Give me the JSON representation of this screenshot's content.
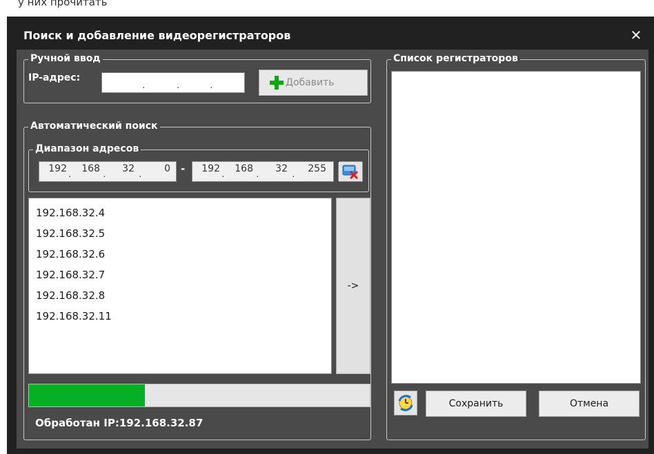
{
  "window": {
    "title": "Поиск и добавление видеорегистраторов",
    "close_glyph": "✕"
  },
  "manual_input": {
    "legend": "Ручной ввод",
    "ip_label": "IP-адрес:",
    "ip_octets": [
      "",
      "",
      "",
      ""
    ],
    "add_button": {
      "label": "Добавить",
      "icon": "plus-icon",
      "enabled": false
    }
  },
  "auto_search": {
    "legend": "Автоматический поиск",
    "range": {
      "legend": "Диапазон адресов",
      "from": [
        "192",
        "168",
        "32",
        "0"
      ],
      "separator": "-",
      "to": [
        "192",
        "168",
        "32",
        "255"
      ],
      "action_icon": "stop-search-icon"
    },
    "found": [
      "192.168.32.4",
      "192.168.32.5",
      "192.168.32.6",
      "192.168.32.7",
      "192.168.32.8",
      "192.168.32.11"
    ],
    "transfer_button": "->",
    "progress_fraction": 0.34,
    "status": "Обработан IP:192.168.32.87"
  },
  "recorders": {
    "legend": "Список регистраторов",
    "items": []
  },
  "footer": {
    "refresh_icon": "refresh-clock-icon",
    "save_label": "Сохранить",
    "cancel_label": "Отмена"
  },
  "colors": {
    "progress": "#06b025",
    "dialog_bg": "#4a4a4a",
    "title_bg": "#212121"
  }
}
